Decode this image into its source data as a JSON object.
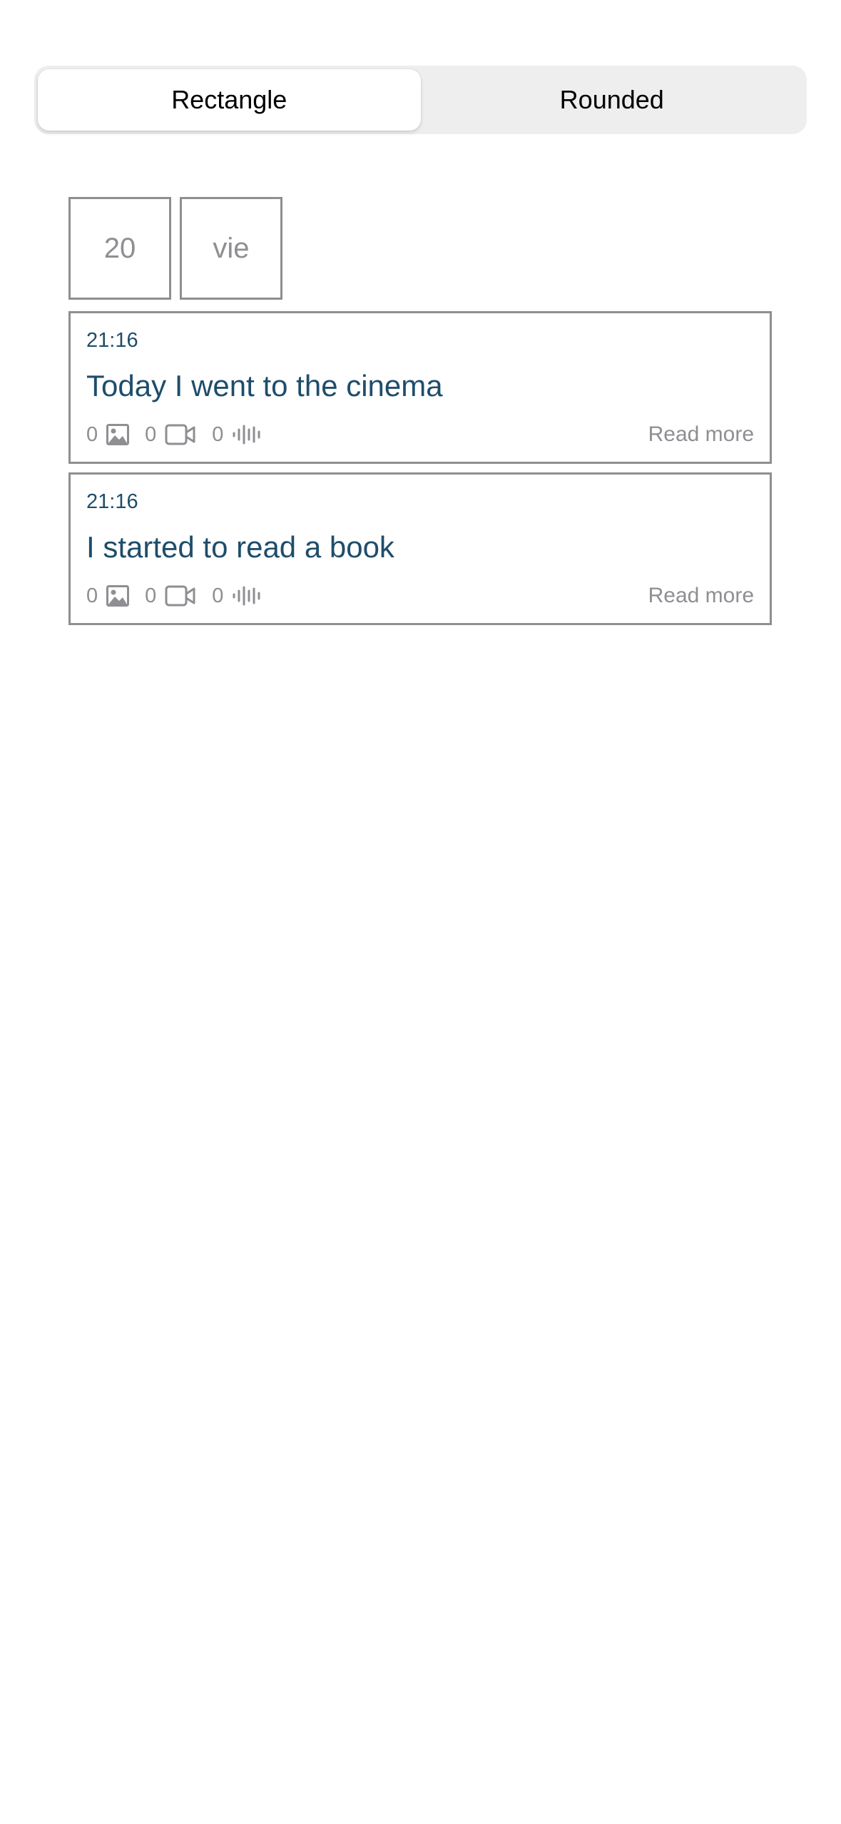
{
  "segmented_control": {
    "options": [
      "Rectangle",
      "Rounded"
    ],
    "selected": "Rectangle"
  },
  "date_header": {
    "day": "20",
    "weekday": "vie"
  },
  "entries": [
    {
      "time": "21:16",
      "title": "Today I went to the cinema",
      "photos": "0",
      "videos": "0",
      "audios": "0",
      "read_more": "Read more"
    },
    {
      "time": "21:16",
      "title": "I started to read a book",
      "photos": "0",
      "videos": "0",
      "audios": "0",
      "read_more": "Read more"
    }
  ],
  "icons": {
    "photo": "photo-icon",
    "video": "video-camera-icon",
    "audio": "audio-waveform-icon"
  },
  "colors": {
    "title": "#1e4d6b",
    "muted": "#8e8e93",
    "segment_bg": "#eeeeee"
  }
}
